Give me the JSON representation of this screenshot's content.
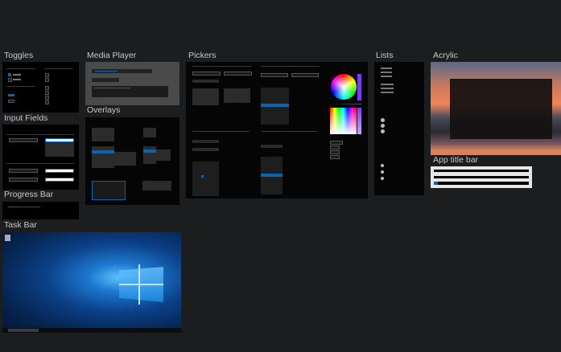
{
  "frames": {
    "toggles": "Toggles",
    "media_player": "Media Player",
    "overlays": "Overlays",
    "input_fields": "Input Fields",
    "progress_bar": "Progress Bar",
    "task_bar": "Task Bar",
    "pickers": "Pickers",
    "lists": "Lists",
    "acrylic": "Acrylic",
    "app_title_bar": "App title bar"
  },
  "colors": {
    "canvas": "#1c1d1f",
    "accent": "#0a64b4"
  }
}
